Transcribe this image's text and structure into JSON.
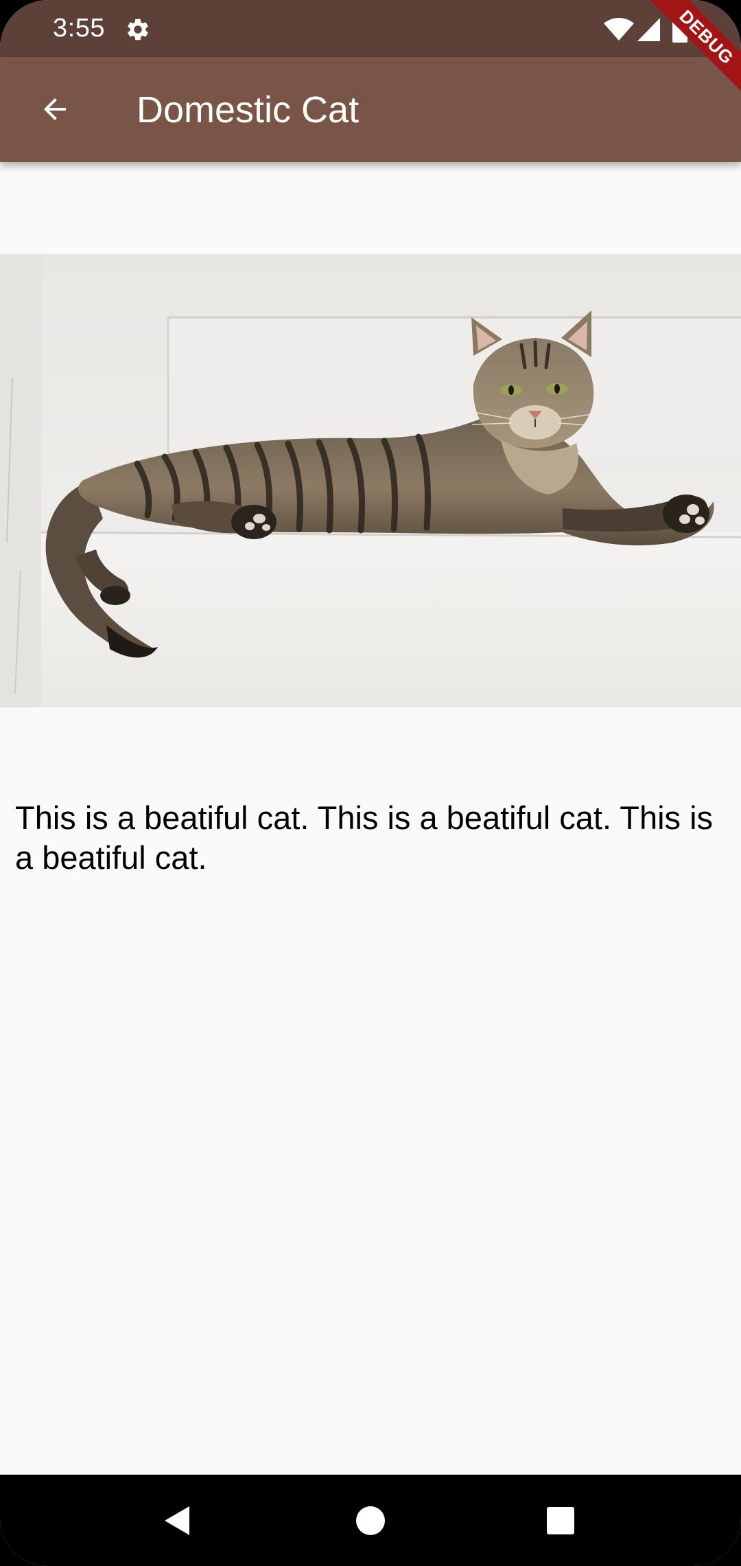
{
  "status_bar": {
    "time": "3:55",
    "icons": [
      "settings-gear-icon",
      "wifi-icon",
      "cell-signal-icon",
      "battery-icon"
    ],
    "background_color": "#5d4037"
  },
  "app_bar": {
    "title": "Domestic Cat",
    "back_icon": "arrow-back-icon",
    "background_color": "#795548"
  },
  "debug_banner": {
    "label": "DEBUG",
    "color": "#a31515"
  },
  "content": {
    "image_subject": "tabby cat lying on white ledge",
    "description": "This is a beatiful cat. This is a beatiful cat. This is a beatiful cat."
  },
  "nav_bar": {
    "icons": [
      "nav-back-triangle-icon",
      "nav-home-circle-icon",
      "nav-recents-square-icon"
    ]
  }
}
